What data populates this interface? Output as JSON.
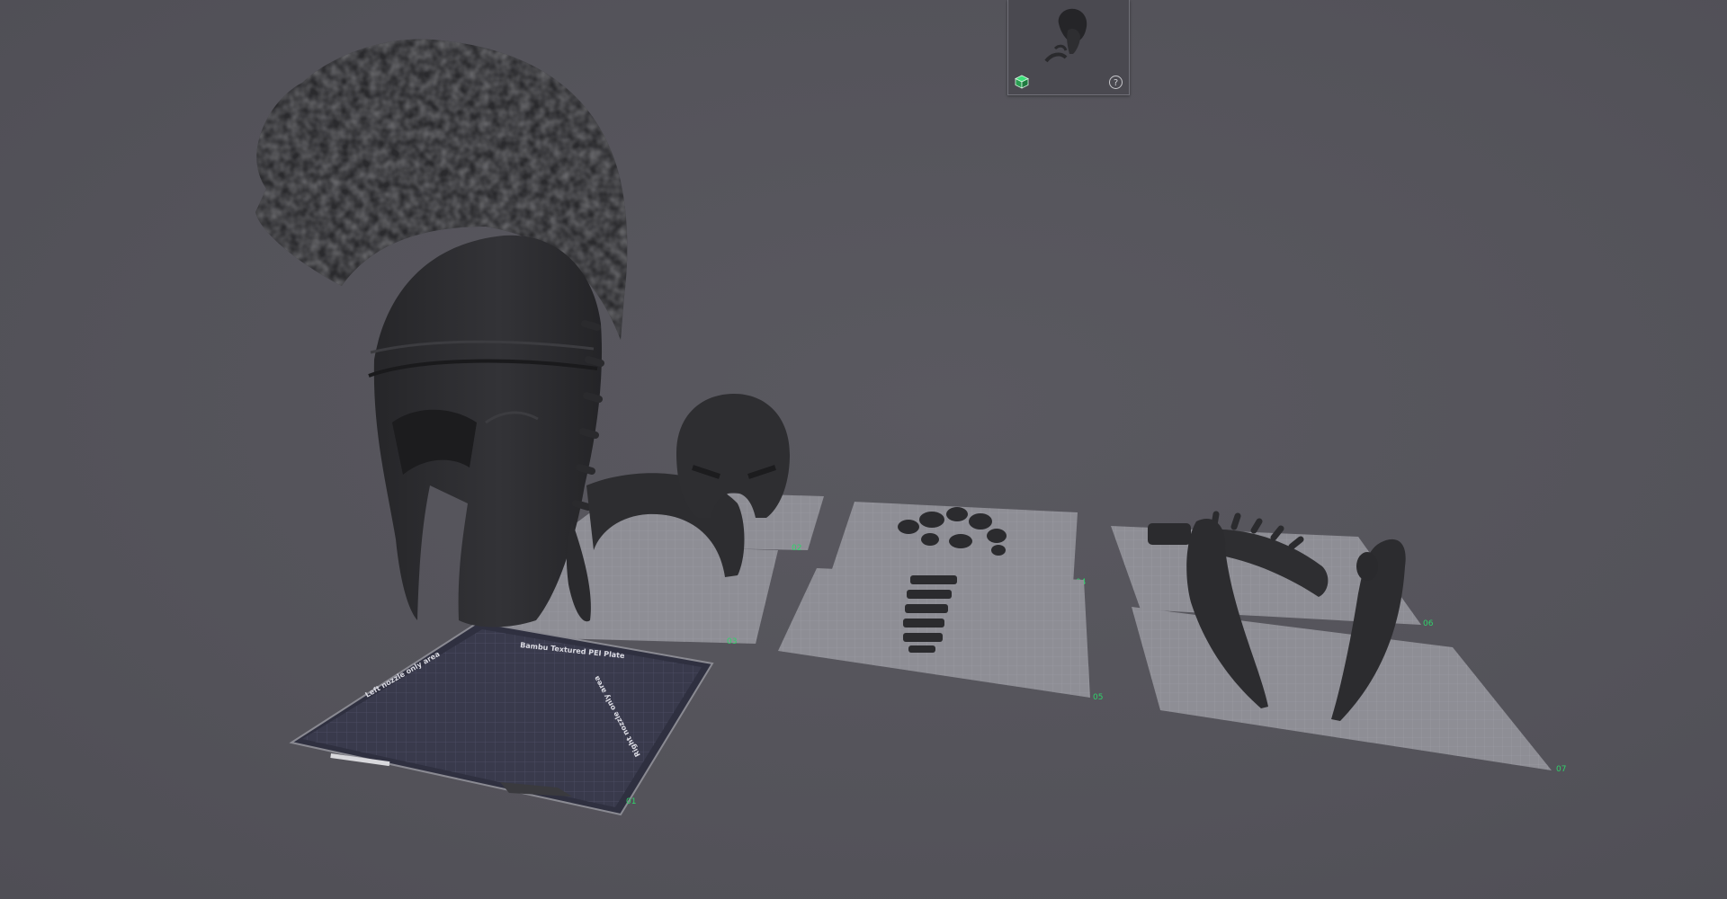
{
  "app": {
    "colors": {
      "background": "#55545b",
      "model": "#2b2b2e",
      "model_highlight": "#3c3c40",
      "plate": "#8f8f96",
      "plate_grid": "#a2a2a9",
      "active_bed": "#393a4c",
      "active_bed_grid": "#4d4f66",
      "accent_green": "#2fd36a"
    }
  },
  "scene": {
    "active_bed": {
      "top_label": "Bambu Textured PEI Plate",
      "left_label": "Left nozzle only area",
      "right_label": "Right nozzle only area",
      "plate_number": "01"
    },
    "plates": [
      {
        "plate_number": "02"
      },
      {
        "plate_number": "03"
      },
      {
        "plate_number": "04"
      },
      {
        "plate_number": "05"
      },
      {
        "plate_number": "06"
      },
      {
        "plate_number": "07"
      }
    ]
  },
  "minimap": {
    "view_cube_icon": "view-cube-icon",
    "help_icon": "help-icon",
    "help_glyph": "?"
  }
}
